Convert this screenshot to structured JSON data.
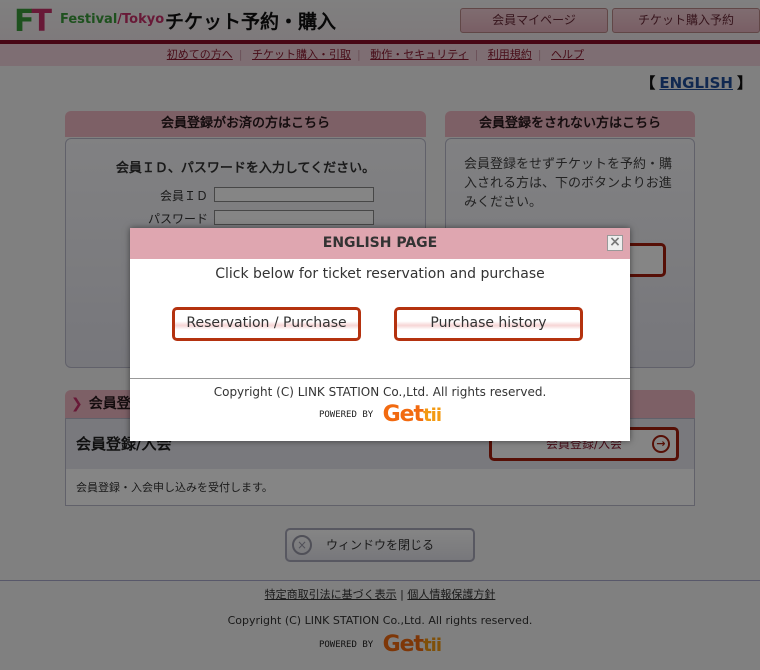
{
  "header": {
    "logo_f": "F",
    "logo_t": "T",
    "logo_festival": "Festival",
    "logo_slash": "/",
    "logo_tokyo": "Tokyo",
    "site_title": "チケット予約・購入",
    "buttons": {
      "mypage": "会員マイページ",
      "ticket": "チケット購入予約"
    }
  },
  "subnav": {
    "items": [
      "初めての方へ",
      "チケット購入・引取",
      "動作・セキュリティ",
      "利用規約",
      "ヘルプ"
    ],
    "separator": "|"
  },
  "language": {
    "open_bracket": "【",
    "label": "ENGLISH",
    "close_bracket": "】"
  },
  "member_login": {
    "heading": "会員登録がお済の方はこちら",
    "instruction": "会員ＩＤ、パスワードを入力してください。",
    "id_label": "会員ＩＤ",
    "id_value": "",
    "password_label": "パスワード",
    "password_value": ""
  },
  "guest": {
    "heading": "会員登録をされない方はこちら",
    "text": "会員登録をせずチケットを予約・購入される方は、下のボタンよりお進みください。"
  },
  "member_signup": {
    "heading": "会員登録/入会",
    "title": "会員登録/入会",
    "button_label": "会員登録/入会",
    "description": "会員登録・入会申し込みを受付します。"
  },
  "close_window": {
    "label": "ウィンドウを閉じる"
  },
  "footer": {
    "link_commerce": "特定商取引法に基づく表示",
    "separator": "|",
    "link_privacy": "個人情報保護方針",
    "copyright": "Copyright (C) LINK STATION Co.,Ltd. All rights reserved.",
    "powered_by": "POWERED BY",
    "brand_main": "Get",
    "brand_tail": "tii"
  },
  "modal": {
    "title": "ENGLISH PAGE",
    "message": "Click below for ticket reservation and purchase",
    "reserve_button": "Reservation / Purchase",
    "history_button": "Purchase history",
    "copyright": "Copyright (C) LINK STATION Co.,Ltd. All rights reserved.",
    "powered_by": "POWERED BY",
    "brand_main": "Get",
    "brand_tail": "tii",
    "close_glyph": "×"
  },
  "colors": {
    "accent_red": "#8b0f2a",
    "header_pink": "#f0b9c3",
    "modal_head": "#dfa6b0",
    "button_border": "#b4320f",
    "link_blue": "#1f4e99",
    "brand_orange": "#f26a10"
  }
}
